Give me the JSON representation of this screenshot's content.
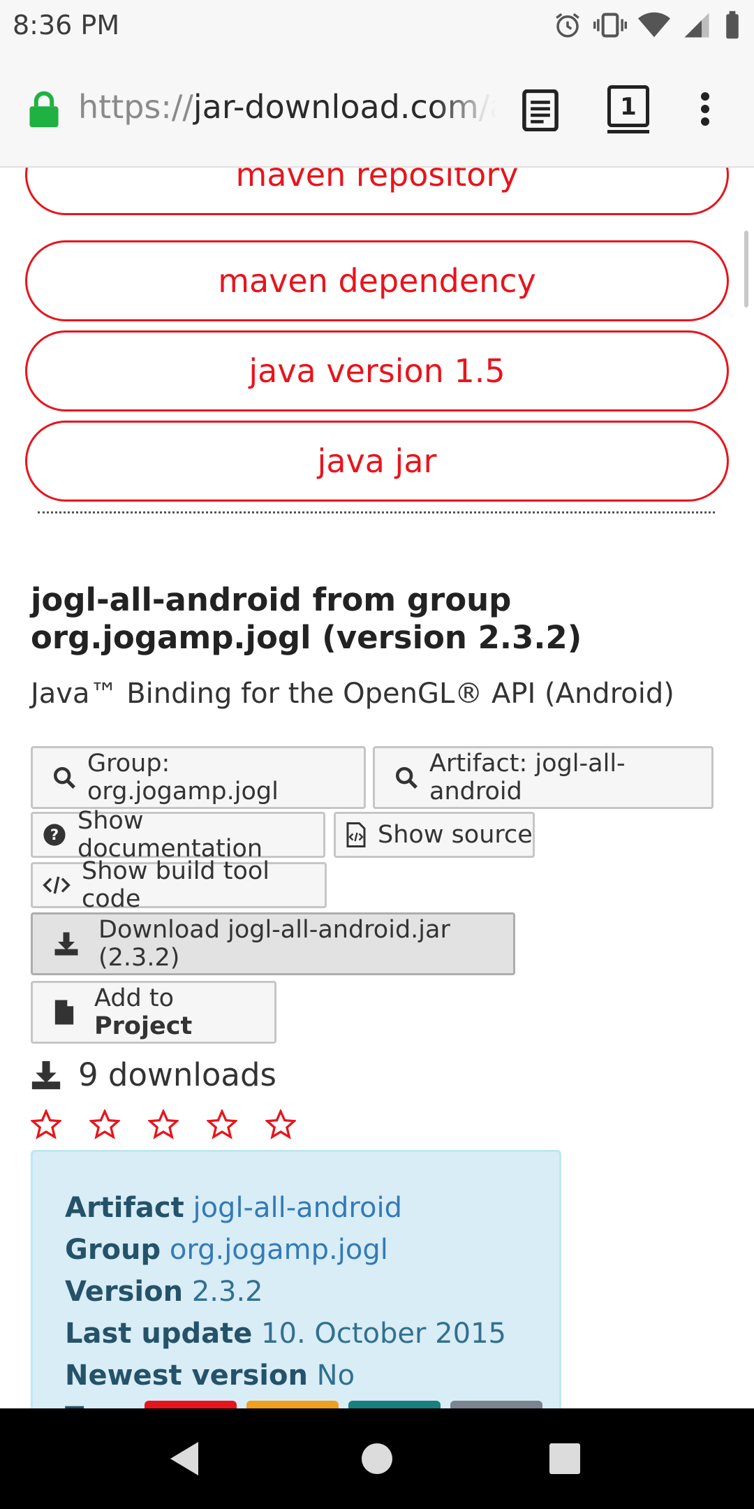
{
  "status_bar": {
    "time": "8:36 PM",
    "icons": [
      "alarm-icon",
      "vibrate-icon",
      "wifi-icon",
      "signal-icon",
      "battery-icon"
    ]
  },
  "browser": {
    "url_scheme": "https://",
    "url_host": "jar-download.com",
    "url_rest": "/ar",
    "tab_count": "1"
  },
  "tags": [
    "maven repository",
    "maven dependency",
    "java version 1.5",
    "java jar"
  ],
  "artifact": {
    "title": "jogl-all-android from group org.jogamp.jogl (version 2.3.2)",
    "description": "Java™ Binding for the OpenGL® API (Android)"
  },
  "buttons": {
    "group": "Group: org.jogamp.jogl",
    "artifact": "Artifact: jogl-all-android",
    "show_documentation": "Show documentation",
    "show_source": "Show source",
    "show_build_tool_code": "Show build tool code",
    "download": "Download jogl-all-android.jar (2.3.2)",
    "add_to": "Add to ",
    "project": "Project"
  },
  "downloads": "9 downloads",
  "rating": {
    "filled": 0,
    "max": 5
  },
  "info": {
    "artifact_label": "Artifact",
    "artifact_value": "jogl-all-android",
    "group_label": "Group",
    "group_value": "org.jogamp.jogl",
    "version_label": "Version",
    "version_value": "2.3.2",
    "last_update_label": "Last update",
    "last_update_value": "10. October 2015",
    "newest_version_label": "Newest version",
    "newest_version_value": "No",
    "tags_label": "Tags",
    "tag_colors": [
      "#e8141c",
      "#f0a01e",
      "#1a7f7f",
      "#7a8590"
    ]
  },
  "colors": {
    "accent_red": "#e8141c",
    "lock_green": "#1fb141",
    "info_text": "#31708f",
    "info_link": "#337ab7"
  }
}
